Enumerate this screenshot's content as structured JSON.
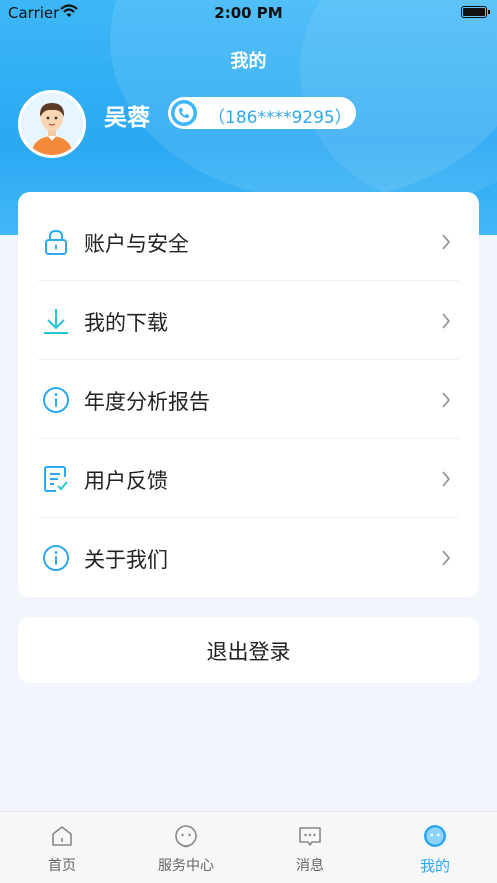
{
  "status_bar": {
    "carrier": "Carrier",
    "time": "2:00 PM"
  },
  "header": {
    "title": "我的",
    "user_name": "吴蓉",
    "phone": "（186****9295）"
  },
  "menu": {
    "items": [
      {
        "label": "账户与安全",
        "icon": "lock-icon"
      },
      {
        "label": "我的下载",
        "icon": "download-icon"
      },
      {
        "label": "年度分析报告",
        "icon": "info-icon"
      },
      {
        "label": "用户反馈",
        "icon": "feedback-icon"
      },
      {
        "label": "关于我们",
        "icon": "info-icon"
      }
    ]
  },
  "logout": {
    "label": "退出登录"
  },
  "tabs": [
    {
      "label": "首页",
      "icon": "home-icon",
      "active": false
    },
    {
      "label": "服务中心",
      "icon": "service-icon",
      "active": false
    },
    {
      "label": "消息",
      "icon": "message-icon",
      "active": false
    },
    {
      "label": "我的",
      "icon": "profile-icon",
      "active": true
    }
  ],
  "colors": {
    "accent": "#2ea8ee",
    "header_top": "#3db7f7",
    "background": "#f2f6fc",
    "icon_teal": "#27c4d6"
  }
}
